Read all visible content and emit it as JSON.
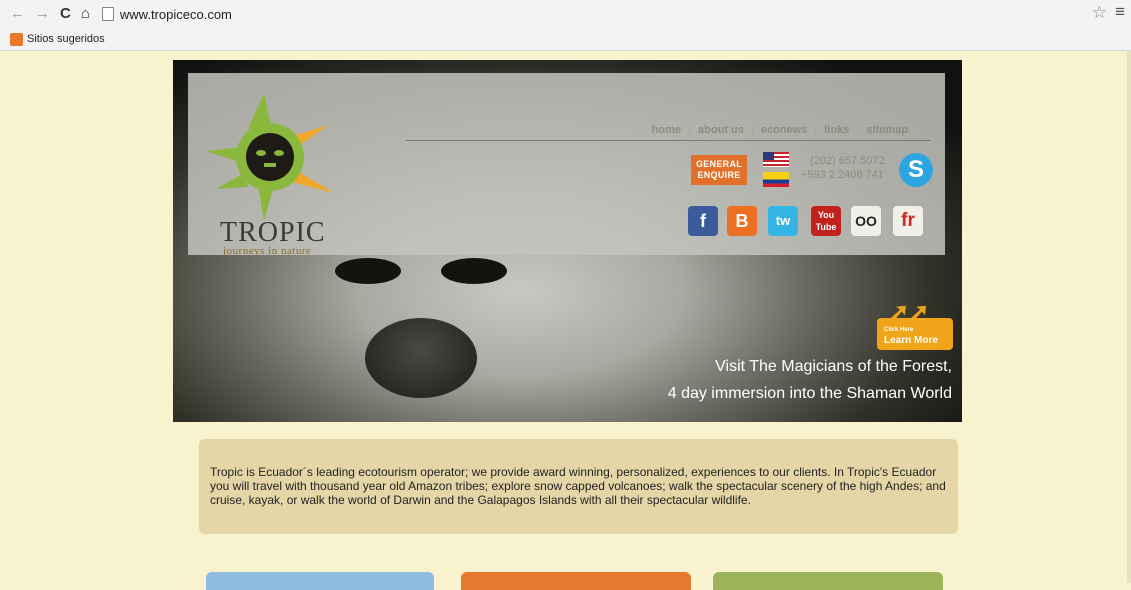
{
  "browser": {
    "url": "www.tropiceco.com",
    "bookmark_label": "Sitios sugeridos",
    "back_icon": "back-arrow-icon",
    "forward_icon": "forward-arrow-icon",
    "reload_icon": "reload-icon",
    "home_icon": "home-icon"
  },
  "site": {
    "logo": "TROPIC",
    "logo_sub": "journeys in nature",
    "nav": [
      "home",
      "about us",
      "econews",
      "links",
      "sitemap"
    ],
    "general_enquire": [
      "GENERAL",
      "ENQUIRE"
    ],
    "phones": [
      "(202) 657 5072",
      "+593 2 2408 741"
    ],
    "social": {
      "facebook": "f",
      "blogger": "B",
      "twitter": "tw",
      "youtube_top": "You",
      "youtube_bottom": "Tube",
      "tripadvisor": "OO",
      "fr": "fr"
    },
    "learn_more_small": "Click Here",
    "learn_more": "Learn More",
    "hero_line_1": "Visit The Magicians of the Forest,",
    "hero_line_2": "4 day immersion into the Shaman World",
    "intro": "Tropic is Ecuador´s leading ecotourism operator; we provide award winning, personalized, experiences to our clients. In Tropic's Ecuador you will travel with thousand year old Amazon tribes; explore snow capped volcanoes; walk the spectacular scenery of the high Andes; and cruise, kayak, or walk the world of Darwin and the Galapagos Islands with all their spectacular wildlife."
  },
  "colors": {
    "page_bg": "#f8f2cf",
    "orange": "#e2702a",
    "blue_tab": "#8fbcdf",
    "orange_tab": "#e7782f",
    "green_tab": "#9eb45a"
  }
}
